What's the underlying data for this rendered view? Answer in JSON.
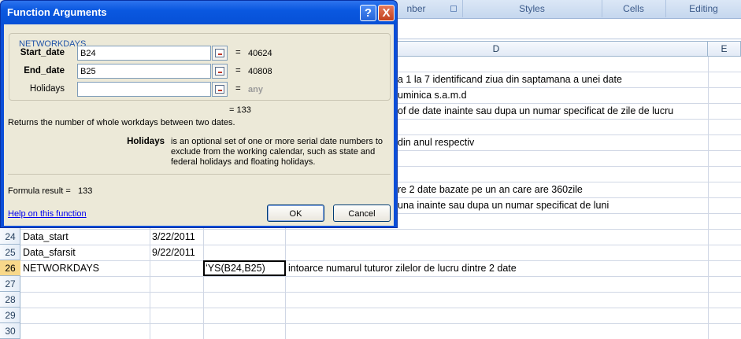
{
  "ribbon": {
    "groups": [
      "nber",
      "Styles",
      "Cells",
      "Editing"
    ]
  },
  "columns": [
    "D",
    "E"
  ],
  "rows": [
    {
      "num": "24",
      "a": "Data_start",
      "b": "3/22/2011",
      "c": "",
      "d": ""
    },
    {
      "num": "25",
      "a": "Data_sfarsit",
      "b": "9/22/2011",
      "c": "",
      "d": ""
    },
    {
      "num": "26",
      "a": "NETWORKDAYS",
      "b": "",
      "c": "ʻYS(B24,B25)",
      "d": "intoarce numarul tuturor zilelor de lucru dintre 2 date"
    },
    {
      "num": "27",
      "a": "",
      "b": "",
      "c": "",
      "d": ""
    },
    {
      "num": "28",
      "a": "",
      "b": "",
      "c": "",
      "d": ""
    },
    {
      "num": "29",
      "a": "",
      "b": "",
      "c": "",
      "d": ""
    },
    {
      "num": "30",
      "a": "",
      "b": "",
      "c": "",
      "d": ""
    }
  ],
  "partial_d": [
    "a 1 la 7 identificand ziua din saptamana a unei date",
    "uminica s.a.m.d",
    "of de date inainte sau dupa un numar specificat de zile de lucru",
    "",
    "din anul respectiv",
    "",
    "",
    "re 2 date bazate pe un an care are 360zile",
    "una inainte sau dupa un numar specificat de luni"
  ],
  "dialog": {
    "title": "Function Arguments",
    "help_glyph": "?",
    "close_glyph": "X",
    "function_name": "NETWORKDAYS",
    "args": [
      {
        "label": "Start_date",
        "value": "B24",
        "eq": "=",
        "result": "40624"
      },
      {
        "label": "End_date",
        "value": "B25",
        "eq": "=",
        "result": "40808"
      },
      {
        "label": "Holidays",
        "value": "",
        "eq": "=",
        "result": "any"
      }
    ],
    "result_line": "=   133",
    "description": "Returns the number of whole workdays between two dates.",
    "arg_name": "Holidays",
    "arg_description": "is an optional set of one or more serial date numbers to exclude from the working calendar, such as state and federal holidays and floating holidays.",
    "formula_result_label": "Formula result =",
    "formula_result_value": "133",
    "help_link": "Help on this function",
    "ok_label": "OK",
    "cancel_label": "Cancel"
  }
}
